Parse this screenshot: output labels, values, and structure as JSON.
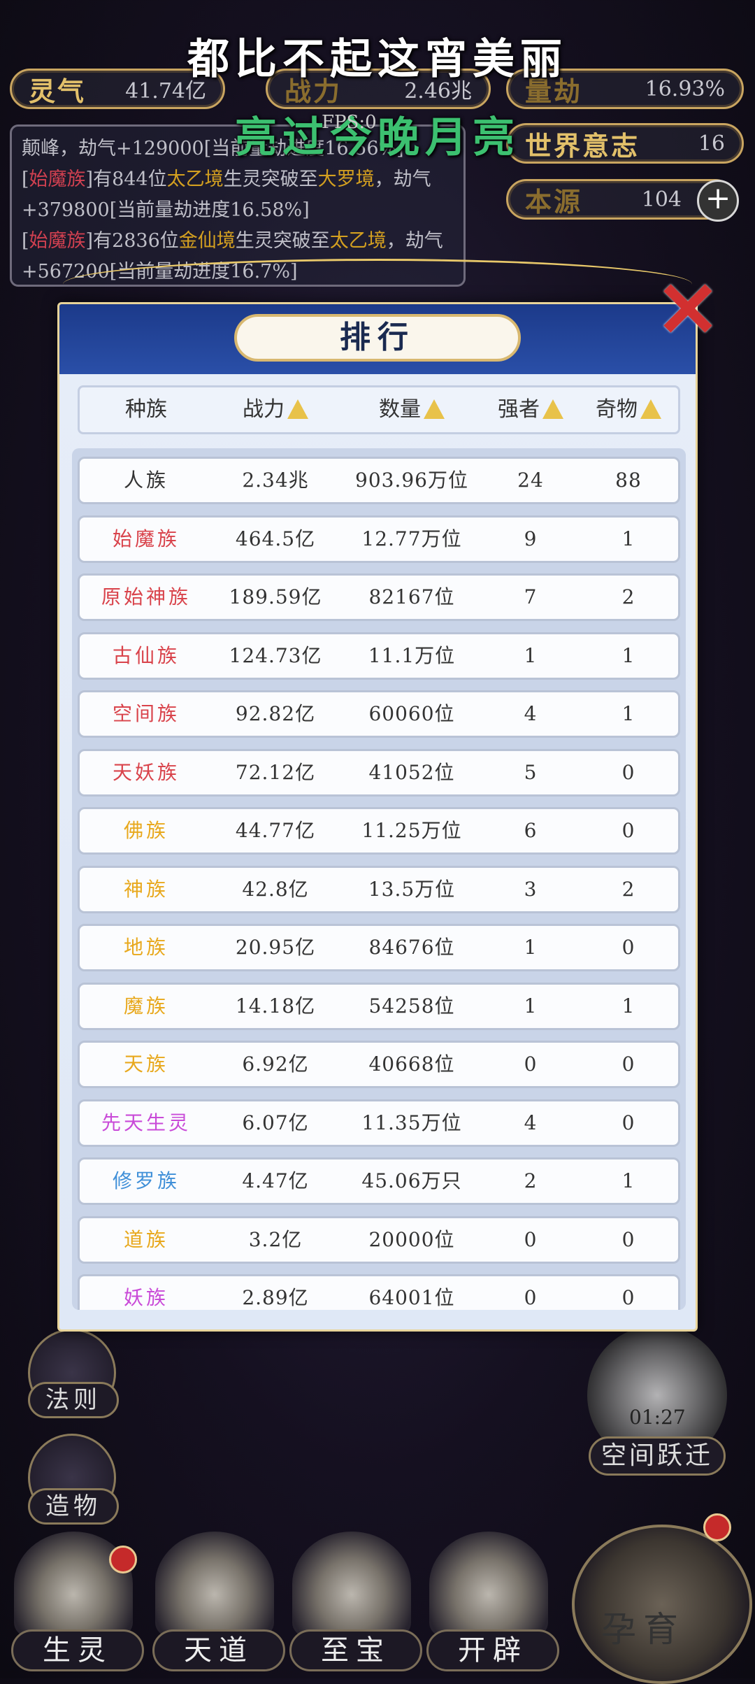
{
  "banner": {
    "line1": "都比不起这宵美丽",
    "line2": "亮过今晚月亮",
    "fps": "FPS:0"
  },
  "hud": {
    "lingqi": {
      "label": "灵气",
      "value": "41.74亿"
    },
    "zhanli": {
      "label": "战力",
      "value": "2.46兆"
    },
    "liangjie": {
      "label": "量劫",
      "value": "16.93%"
    },
    "shijie": {
      "label": "世界意志",
      "value": "16"
    },
    "benyuan": {
      "label": "本源",
      "value": "104",
      "plus": "+"
    }
  },
  "log": {
    "line1": "颠峰，劫气+129000[当前量劫进度16.56%]",
    "line2_prefix": "[",
    "line2_race": "始魔族",
    "line2_mid": "]有844位",
    "line2_realm": "太乙境",
    "line2_mid2": "生灵突破至",
    "line2_realm2": "大罗境",
    "line2_suffix": "，劫气+379800[当前量劫进度16.58%]",
    "line3_prefix": "[",
    "line3_race": "始魔族",
    "line3_mid": "]有2836位",
    "line3_realm": "金仙境",
    "line3_mid2": "生灵突破至",
    "line3_realm2": "太乙境",
    "line3_suffix": "，劫气+567200[当前量劫进度16.7%]"
  },
  "modal": {
    "title": "排行",
    "close_icon": "close-x-icon",
    "headers": {
      "race": "种族",
      "power": "战力",
      "count": "数量",
      "strong": "强者",
      "treasure": "奇物"
    },
    "rows": [
      {
        "race": "人族",
        "power": "2.34兆",
        "count": "903.96万位",
        "strong": "24",
        "treasure": "88",
        "color": "#333333"
      },
      {
        "race": "始魔族",
        "power": "464.5亿",
        "count": "12.77万位",
        "strong": "9",
        "treasure": "1",
        "color": "#d9434b"
      },
      {
        "race": "原始神族",
        "power": "189.59亿",
        "count": "82167位",
        "strong": "7",
        "treasure": "2",
        "color": "#d9434b"
      },
      {
        "race": "古仙族",
        "power": "124.73亿",
        "count": "11.1万位",
        "strong": "1",
        "treasure": "1",
        "color": "#d9434b"
      },
      {
        "race": "空间族",
        "power": "92.82亿",
        "count": "60060位",
        "strong": "4",
        "treasure": "1",
        "color": "#d9434b"
      },
      {
        "race": "天妖族",
        "power": "72.12亿",
        "count": "41052位",
        "strong": "5",
        "treasure": "0",
        "color": "#d9434b"
      },
      {
        "race": "佛族",
        "power": "44.77亿",
        "count": "11.25万位",
        "strong": "6",
        "treasure": "0",
        "color": "#e8a81c"
      },
      {
        "race": "神族",
        "power": "42.8亿",
        "count": "13.5万位",
        "strong": "3",
        "treasure": "2",
        "color": "#e8a81c"
      },
      {
        "race": "地族",
        "power": "20.95亿",
        "count": "84676位",
        "strong": "1",
        "treasure": "0",
        "color": "#e8a81c"
      },
      {
        "race": "魔族",
        "power": "14.18亿",
        "count": "54258位",
        "strong": "1",
        "treasure": "1",
        "color": "#e8a81c"
      },
      {
        "race": "天族",
        "power": "6.92亿",
        "count": "40668位",
        "strong": "0",
        "treasure": "0",
        "color": "#e8a81c"
      },
      {
        "race": "先天生灵",
        "power": "6.07亿",
        "count": "11.35万位",
        "strong": "4",
        "treasure": "0",
        "color": "#c94ad8"
      },
      {
        "race": "修罗族",
        "power": "4.47亿",
        "count": "45.06万只",
        "strong": "2",
        "treasure": "1",
        "color": "#3f8fd8"
      },
      {
        "race": "道族",
        "power": "3.2亿",
        "count": "20000位",
        "strong": "0",
        "treasure": "0",
        "color": "#e8a81c"
      },
      {
        "race": "妖族",
        "power": "2.89亿",
        "count": "64001位",
        "strong": "0",
        "treasure": "0",
        "color": "#c94ad8"
      }
    ]
  },
  "side": {
    "fazhe": "法则",
    "zaowu": "造物",
    "kongjian": "空间跃迁",
    "timer": "01:27"
  },
  "bottom": {
    "shengling": "生灵",
    "tiandao": "天道",
    "zhibao": "至宝",
    "kaipi": "开辟",
    "yunyu": "孕育"
  }
}
